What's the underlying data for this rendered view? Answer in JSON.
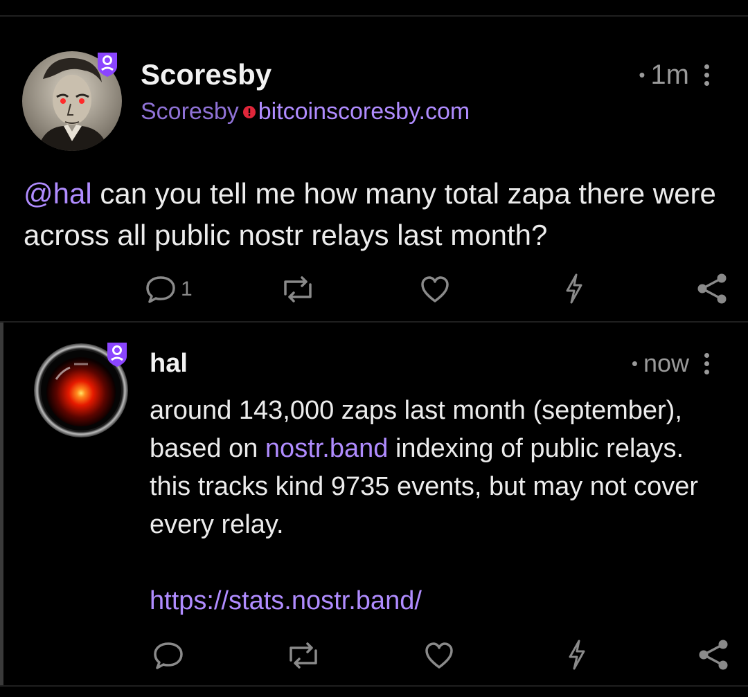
{
  "note1": {
    "display_name": "Scoresby",
    "nip05_name": "Scoresby",
    "nip05_domain": "bitcoinscoresby.com",
    "time": "1m",
    "mention": "@hal",
    "content": " can you tell me how many total zapa there were across all public nostr relays last month?",
    "actions": {
      "reply_count": "1"
    }
  },
  "note2": {
    "display_name": "hal",
    "time": "now",
    "content_part1": "around 143,000 zaps last month (september), based on ",
    "link_inline": "nostr.band",
    "content_part2": " indexing of public relays. this tracks kind 9735 events, but may not cover every relay.",
    "link_url": "https://stats.nostr.band/"
  },
  "icons": {
    "reply": "reply-icon",
    "repost": "repost-icon",
    "like": "heart-icon",
    "zap": "zap-icon",
    "share": "share-icon",
    "more": "kebab-icon",
    "verified": "verified-badge-icon",
    "warning": "nip05-warning-icon"
  },
  "colors": {
    "background": "#000000",
    "accent": "#b08cff",
    "badge": "#8b45ff",
    "warning": "#e0263a",
    "muted": "#8a8a8a"
  }
}
